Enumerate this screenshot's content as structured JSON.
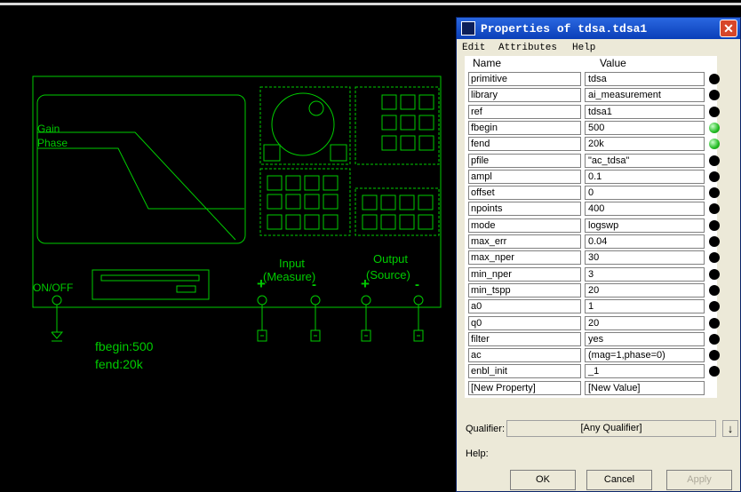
{
  "instrument": {
    "labels": {
      "gain": "Gain",
      "phase": "Phase",
      "on_off": "ON/OFF",
      "input": "Input",
      "measure": "(Measure)",
      "output": "Output",
      "source": "(Source)",
      "plus": "+",
      "minus": "-",
      "fbegin": "fbegin:500",
      "fend": "fend:20k"
    }
  },
  "dialog": {
    "title": "Properties of tdsa.tdsa1",
    "menu": [
      "Edit",
      "Attributes",
      "Help"
    ],
    "columns": {
      "name": "Name",
      "value": "Value"
    },
    "properties": [
      {
        "name": "primitive",
        "value": "tdsa",
        "status": "black",
        "locked": true
      },
      {
        "name": "library",
        "value": "ai_measurement",
        "status": "black"
      },
      {
        "name": "ref",
        "value": "tdsa1",
        "status": "black"
      },
      {
        "name": "fbegin",
        "value": "500",
        "status": "green"
      },
      {
        "name": "fend",
        "value": "20k",
        "status": "green"
      },
      {
        "name": "pfile",
        "value": "\"ac_tdsa\"",
        "status": "black"
      },
      {
        "name": "ampl",
        "value": "0.1",
        "status": "black"
      },
      {
        "name": "offset",
        "value": "0",
        "status": "black"
      },
      {
        "name": "npoints",
        "value": "400",
        "status": "black"
      },
      {
        "name": "mode",
        "value": "logswp",
        "status": "black"
      },
      {
        "name": "max_err",
        "value": "0.04",
        "status": "black"
      },
      {
        "name": "max_nper",
        "value": "30",
        "status": "black"
      },
      {
        "name": "min_nper",
        "value": "3",
        "status": "black"
      },
      {
        "name": "min_tspp",
        "value": "20",
        "status": "black"
      },
      {
        "name": "a0",
        "value": "1",
        "status": "black"
      },
      {
        "name": "q0",
        "value": "20",
        "status": "black"
      },
      {
        "name": "filter",
        "value": "yes",
        "status": "black"
      },
      {
        "name": "ac",
        "value": "(mag=1,phase=0)",
        "status": "black"
      },
      {
        "name": "enbl_init",
        "value": "_1",
        "status": "black"
      },
      {
        "name": "[New Property]",
        "value": "[New Value]",
        "status": "none"
      }
    ],
    "qualifier_label": "Qualifier:",
    "qualifier_value": "[Any Qualifier]",
    "help_label": "Help:",
    "buttons": {
      "ok": "OK",
      "cancel": "Cancel",
      "apply": "Apply"
    },
    "colors": {
      "title_bar": "#0a3fb8",
      "status_green": "#22bb22"
    }
  }
}
